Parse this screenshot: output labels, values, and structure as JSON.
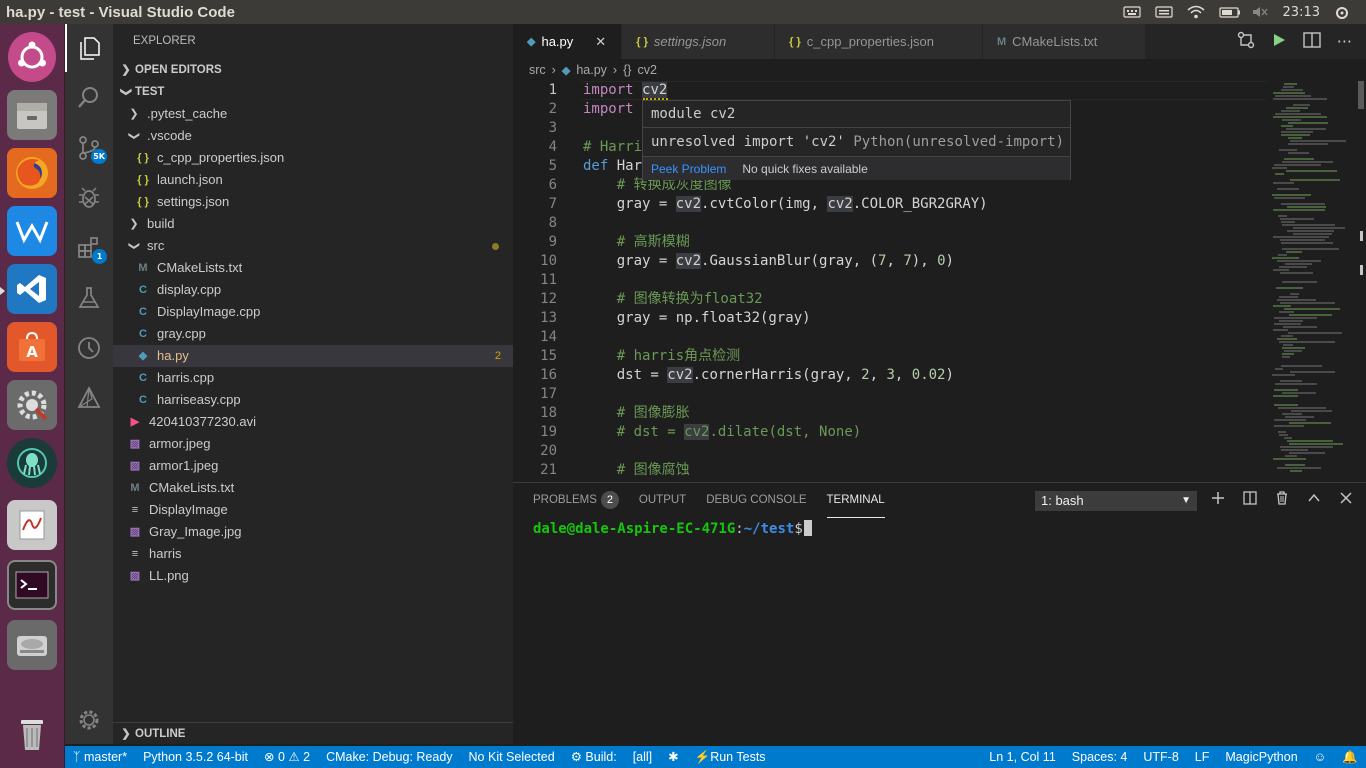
{
  "window": {
    "title": "ha.py - test - Visual Studio Code"
  },
  "tray": {
    "time": "23:13"
  },
  "launcher": {
    "items": [
      "Ubuntu Dash",
      "Files",
      "Firefox",
      "WPS Writer",
      "Visual Studio Code",
      "Ubuntu Software",
      "System Settings",
      "GitKraken",
      "Document Viewer",
      "Terminal",
      "Disk",
      "Trash"
    ]
  },
  "activity": {
    "scm_badge": "5K",
    "extensions_badge": "1"
  },
  "sidebar": {
    "title": "EXPLORER",
    "open_editors": "OPEN EDITORS",
    "workspace": "TEST",
    "outline": "OUTLINE",
    "tree": [
      {
        "label": ".pytest_cache",
        "kind": "folder",
        "open": false,
        "depth": 1
      },
      {
        "label": ".vscode",
        "kind": "folder",
        "open": true,
        "depth": 1
      },
      {
        "label": "c_cpp_properties.json",
        "kind": "json",
        "depth": 2
      },
      {
        "label": "launch.json",
        "kind": "json",
        "depth": 2
      },
      {
        "label": "settings.json",
        "kind": "json",
        "depth": 2
      },
      {
        "label": "build",
        "kind": "folder",
        "open": false,
        "depth": 1
      },
      {
        "label": "src",
        "kind": "folder",
        "open": true,
        "depth": 1,
        "modified_dot": true
      },
      {
        "label": "CMakeLists.txt",
        "kind": "cmake",
        "depth": 2
      },
      {
        "label": "display.cpp",
        "kind": "cpp",
        "depth": 2
      },
      {
        "label": "DisplayImage.cpp",
        "kind": "cpp",
        "depth": 2
      },
      {
        "label": "gray.cpp",
        "kind": "cpp",
        "depth": 2
      },
      {
        "label": "ha.py",
        "kind": "py",
        "depth": 2,
        "selected": true,
        "badge": "2"
      },
      {
        "label": "harris.cpp",
        "kind": "cpp",
        "depth": 2
      },
      {
        "label": "harriseasy.cpp",
        "kind": "cpp",
        "depth": 2
      },
      {
        "label": "420410377230.avi",
        "kind": "video",
        "depth": 1
      },
      {
        "label": "armor.jpeg",
        "kind": "image",
        "depth": 1
      },
      {
        "label": "armor1.jpeg",
        "kind": "image",
        "depth": 1
      },
      {
        "label": "CMakeLists.txt",
        "kind": "cmake",
        "depth": 1
      },
      {
        "label": "DisplayImage",
        "kind": "file",
        "depth": 1
      },
      {
        "label": "Gray_Image.jpg",
        "kind": "image",
        "depth": 1
      },
      {
        "label": "harris",
        "kind": "file",
        "depth": 1
      },
      {
        "label": "LL.png",
        "kind": "image",
        "depth": 1
      }
    ]
  },
  "tabs": [
    {
      "label": "ha.py",
      "kind": "py",
      "active": true,
      "italic": false
    },
    {
      "label": "settings.json",
      "kind": "json",
      "active": false,
      "italic": true
    },
    {
      "label": "c_cpp_properties.json",
      "kind": "json",
      "active": false,
      "italic": false
    },
    {
      "label": "CMakeLists.txt",
      "kind": "cmake",
      "active": false,
      "italic": false
    }
  ],
  "breadcrumb": {
    "folder": "src",
    "file": "ha.py",
    "symbol": "cv2"
  },
  "code_lines": [
    {
      "n": "1",
      "html": "<span class=\"kw\">import</span> <span class=\"hl\">cv2</span>"
    },
    {
      "n": "2",
      "html": "<span class=\"kw\">import</span>"
    },
    {
      "n": "3",
      "html": ""
    },
    {
      "n": "4",
      "html": "<span class=\"cm\"># Harri</span>"
    },
    {
      "n": "5",
      "html": "<span class=\"kw2\">def</span> Har"
    },
    {
      "n": "6",
      "html": "    <span class=\"cm\"># 转换成灰度图像</span>"
    },
    {
      "n": "7",
      "html": "    gray = <span class=\"hl\">cv2</span>.cvtColor(img, <span class=\"hl\">cv2</span>.COLOR_BGR2GRAY)"
    },
    {
      "n": "8",
      "html": ""
    },
    {
      "n": "9",
      "html": "    <span class=\"cm\"># 高斯模糊</span>"
    },
    {
      "n": "10",
      "html": "    gray = <span class=\"hl\">cv2</span>.GaussianBlur(gray, (<span class=\"num\">7</span>, <span class=\"num\">7</span>), <span class=\"num\">0</span>)"
    },
    {
      "n": "11",
      "html": ""
    },
    {
      "n": "12",
      "html": "    <span class=\"cm\"># 图像转换为float32</span>"
    },
    {
      "n": "13",
      "html": "    gray = np.float32(gray)"
    },
    {
      "n": "14",
      "html": ""
    },
    {
      "n": "15",
      "html": "    <span class=\"cm\"># harris角点检测</span>"
    },
    {
      "n": "16",
      "html": "    dst = <span class=\"hl\">cv2</span>.cornerHarris(gray, <span class=\"num\">2</span>, <span class=\"num\">3</span>, <span class=\"num\">0.02</span>)"
    },
    {
      "n": "17",
      "html": ""
    },
    {
      "n": "18",
      "html": "    <span class=\"cm\"># 图像膨胀</span>"
    },
    {
      "n": "19",
      "html": "    <span class=\"cm\"># dst = <span class=\"hl\">cv2</span>.dilate(dst, None)</span>"
    },
    {
      "n": "20",
      "html": ""
    },
    {
      "n": "21",
      "html": "    <span class=\"cm\"># 图像腐蚀</span>"
    }
  ],
  "hover": {
    "module": "module cv2",
    "problem": "unresolved import 'cv2'",
    "source": "Python(unresolved-import)",
    "peek": "Peek Problem",
    "no_fix": "No quick fixes available"
  },
  "panel": {
    "tabs": [
      {
        "label": "PROBLEMS",
        "badge": "2",
        "active": false
      },
      {
        "label": "OUTPUT",
        "active": false
      },
      {
        "label": "DEBUG CONSOLE",
        "active": false
      },
      {
        "label": "TERMINAL",
        "active": true
      }
    ],
    "terminal_select": "1: bash",
    "prompt_user": "dale@dale-Aspire-EC-471G",
    "prompt_sep": ":",
    "prompt_path": "~/test",
    "prompt_end": "$"
  },
  "status": {
    "branch": "master*",
    "python": "Python 3.5.2 64-bit",
    "errors": "0",
    "warnings": "2",
    "cmake": "CMake: Debug: Ready",
    "kit": "No Kit Selected",
    "build": "Build:",
    "target": "[all]",
    "run_tests": "Run Tests",
    "position": "Ln 1, Col 11",
    "spaces": "Spaces: 4",
    "encoding": "UTF-8",
    "eol": "LF",
    "language": "MagicPython"
  },
  "colors": {
    "accent": "#007acc",
    "launcher": "#5a2a48"
  }
}
